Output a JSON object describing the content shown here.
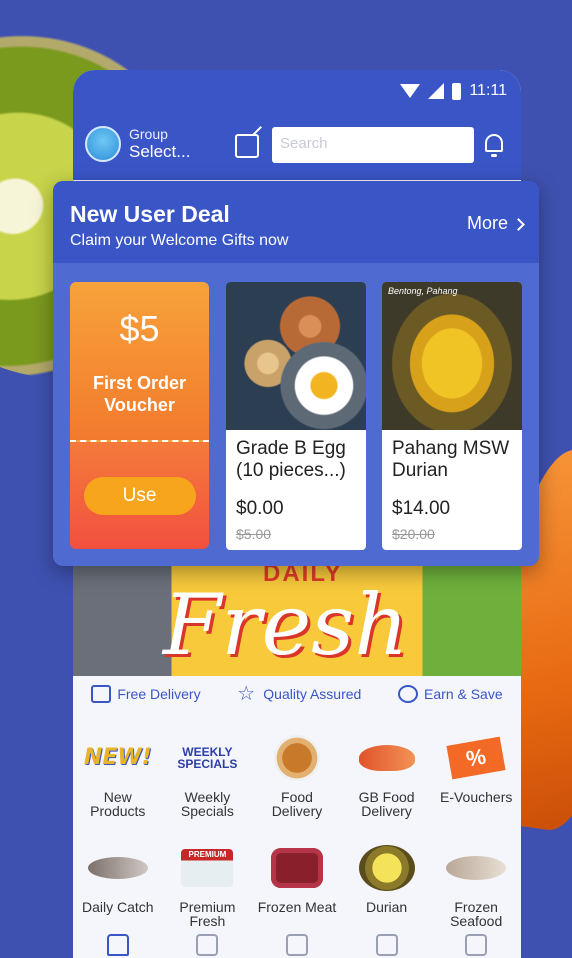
{
  "status_bar": {
    "time": "11:11"
  },
  "header": {
    "group_label": "Group",
    "group_value": "Select...",
    "search_placeholder": "Search"
  },
  "deal": {
    "title": "New User Deal",
    "subtitle": "Claim your Welcome Gifts now",
    "more_label": "More",
    "voucher": {
      "amount": "$5",
      "label": "First Order Voucher",
      "button": "Use"
    },
    "products": [
      {
        "name": "Grade B Egg (10 pieces...)",
        "price": "$0.00",
        "old_price": "$5.00",
        "image": "eggs"
      },
      {
        "name": "Pahang MSW Durian",
        "price": "$14.00",
        "old_price": "$20.00",
        "image": "durian",
        "image_caption": "Bentong, Pahang"
      }
    ]
  },
  "banner": {
    "small": "DAILY",
    "title": "Fresh"
  },
  "features": [
    {
      "label": "Free Delivery",
      "icon": "truck-icon"
    },
    {
      "label": "Quality Assured",
      "icon": "star-icon"
    },
    {
      "label": "Earn & Save",
      "icon": "dollar-icon"
    }
  ],
  "categories_row1": [
    {
      "label": "New Products",
      "badge": "NEW!"
    },
    {
      "label": "Weekly Specials",
      "badge": "WEEKLY SPECIALS"
    },
    {
      "label": "Food Delivery"
    },
    {
      "label": "GB Food Delivery"
    },
    {
      "label": "E-Vouchers",
      "badge": "%"
    }
  ],
  "categories_row2": [
    {
      "label": "Daily Catch"
    },
    {
      "label": "Premium Fresh",
      "badge": "PREMIUM"
    },
    {
      "label": "Frozen Meat"
    },
    {
      "label": "Durian"
    },
    {
      "label": "Frozen Seafood"
    }
  ],
  "tabbar": [
    "home-icon",
    "grid-icon",
    "video-icon",
    "cart-icon",
    "profile-icon"
  ],
  "colors": {
    "brand": "#3a55c6",
    "accent": "#f27a2c",
    "background": "#3f51b0"
  }
}
